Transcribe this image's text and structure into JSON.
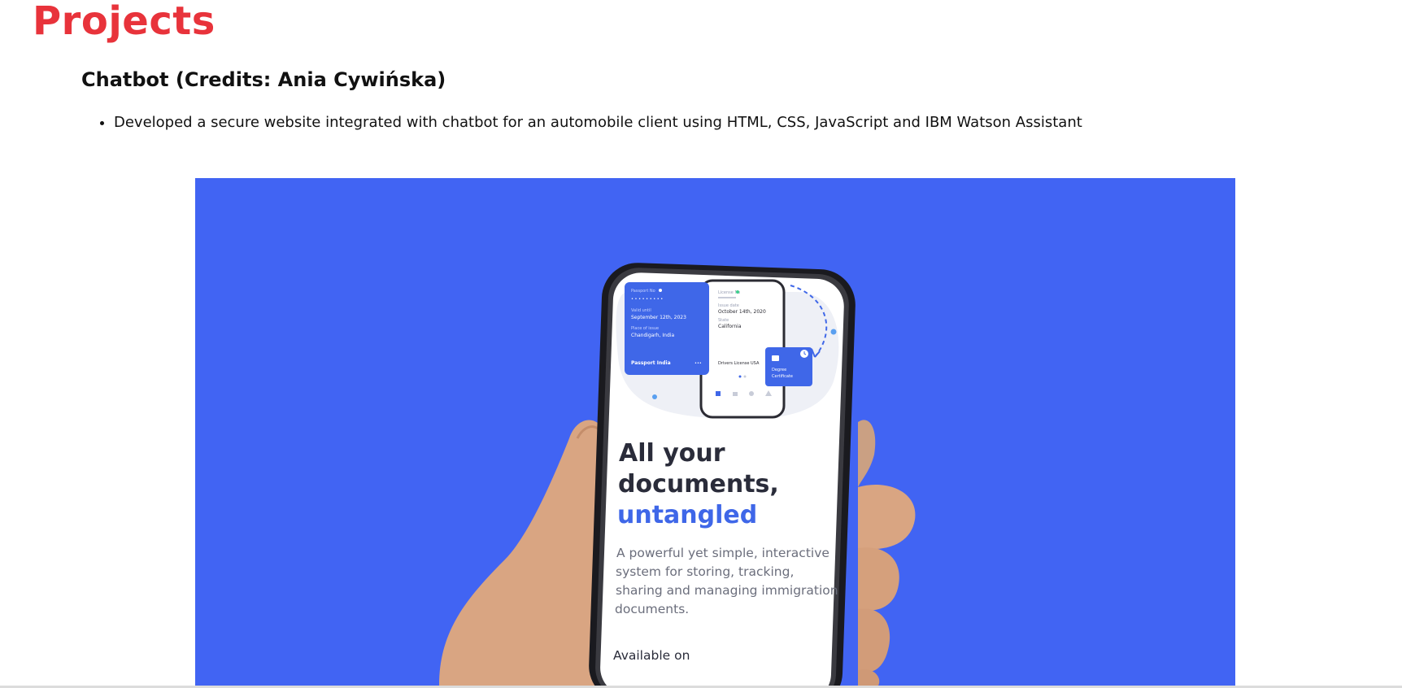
{
  "page": {
    "title": "Projects"
  },
  "project": {
    "title": "Chatbot (Credits: Ania Cywińska)",
    "bullets": [
      "Developed a secure website integrated with chatbot for an automobile client using HTML, CSS, JavaScript and IBM Watson Assistant"
    ]
  },
  "hero": {
    "background_color": "#4164f3",
    "accent_color": "#3f67e8",
    "passport_card": {
      "label_number": "Passport No",
      "masked": "• • • • • • • • •",
      "label_valid": "Valid until",
      "valid_until": "September 12th, 2023",
      "label_place": "Place of issue",
      "place": "Chandigarh, India",
      "footer": "Passport India",
      "more": "•••"
    },
    "license_card": {
      "label_license": "License No",
      "label_issue": "Issue date",
      "issue_date": "October 14th, 2020",
      "label_state": "State",
      "state": "California",
      "footer": "Drivers License USA"
    },
    "degree_card": {
      "label_line1": "Degree",
      "label_line2": "Certificate"
    },
    "headline_line1": "All your",
    "headline_line2": "documents,",
    "headline_accent": "untangled",
    "description_line1": "A powerful yet simple, interactive",
    "description_line2": "system for storing, tracking,",
    "description_line3": "sharing and managing immigration",
    "description_line4": "documents.",
    "available_label": "Available on",
    "icons": [
      "folder-icon",
      "clock-icon",
      "hand-icon",
      "phone-icon"
    ]
  }
}
